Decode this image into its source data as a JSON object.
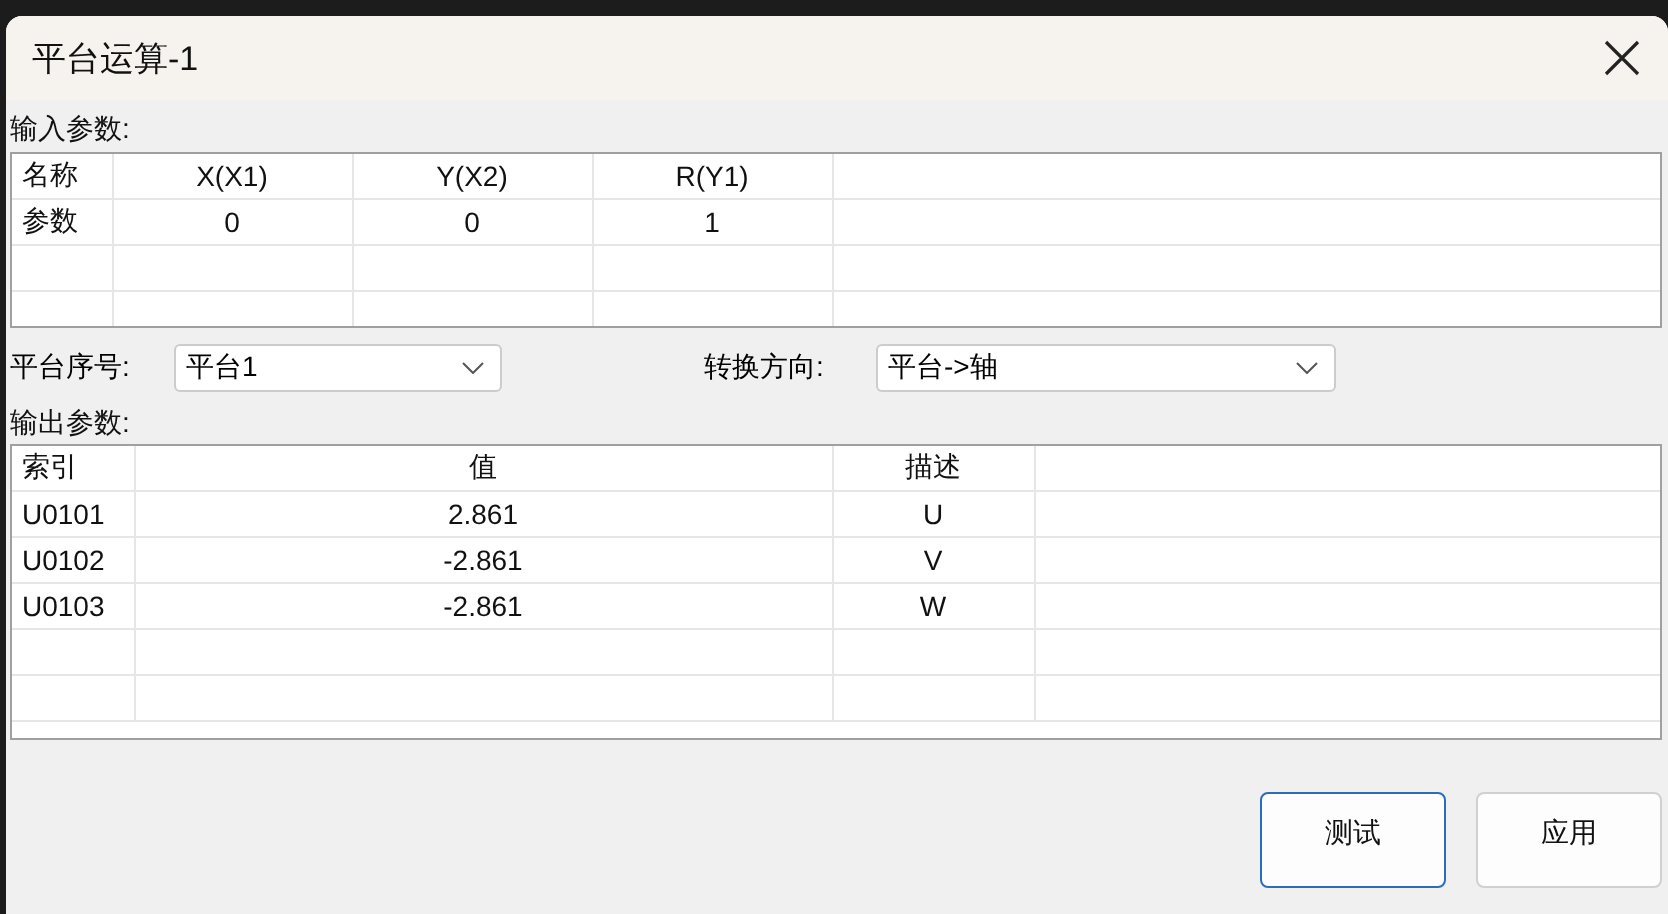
{
  "window": {
    "title": "平台运算-1"
  },
  "input_params": {
    "label": "输入参数:",
    "columns": [
      "名称",
      "X(X1)",
      "Y(X2)",
      "R(Y1)"
    ],
    "rows": [
      [
        "参数",
        "0",
        "0",
        "1"
      ]
    ]
  },
  "selectors": [
    {
      "label": "平台序号:",
      "value": "平台1"
    },
    {
      "label": "转换方向:",
      "value": "平台->轴"
    }
  ],
  "output_params": {
    "label": "输出参数:",
    "columns": [
      "索引",
      "值",
      "描述"
    ],
    "rows": [
      [
        "U0101",
        "2.861",
        "U"
      ],
      [
        "U0102",
        "-2.861",
        "V"
      ],
      [
        "U0103",
        "-2.861",
        "W"
      ]
    ]
  },
  "buttons": [
    {
      "label": "测试",
      "default": true
    },
    {
      "label": "应用",
      "default": false
    }
  ]
}
